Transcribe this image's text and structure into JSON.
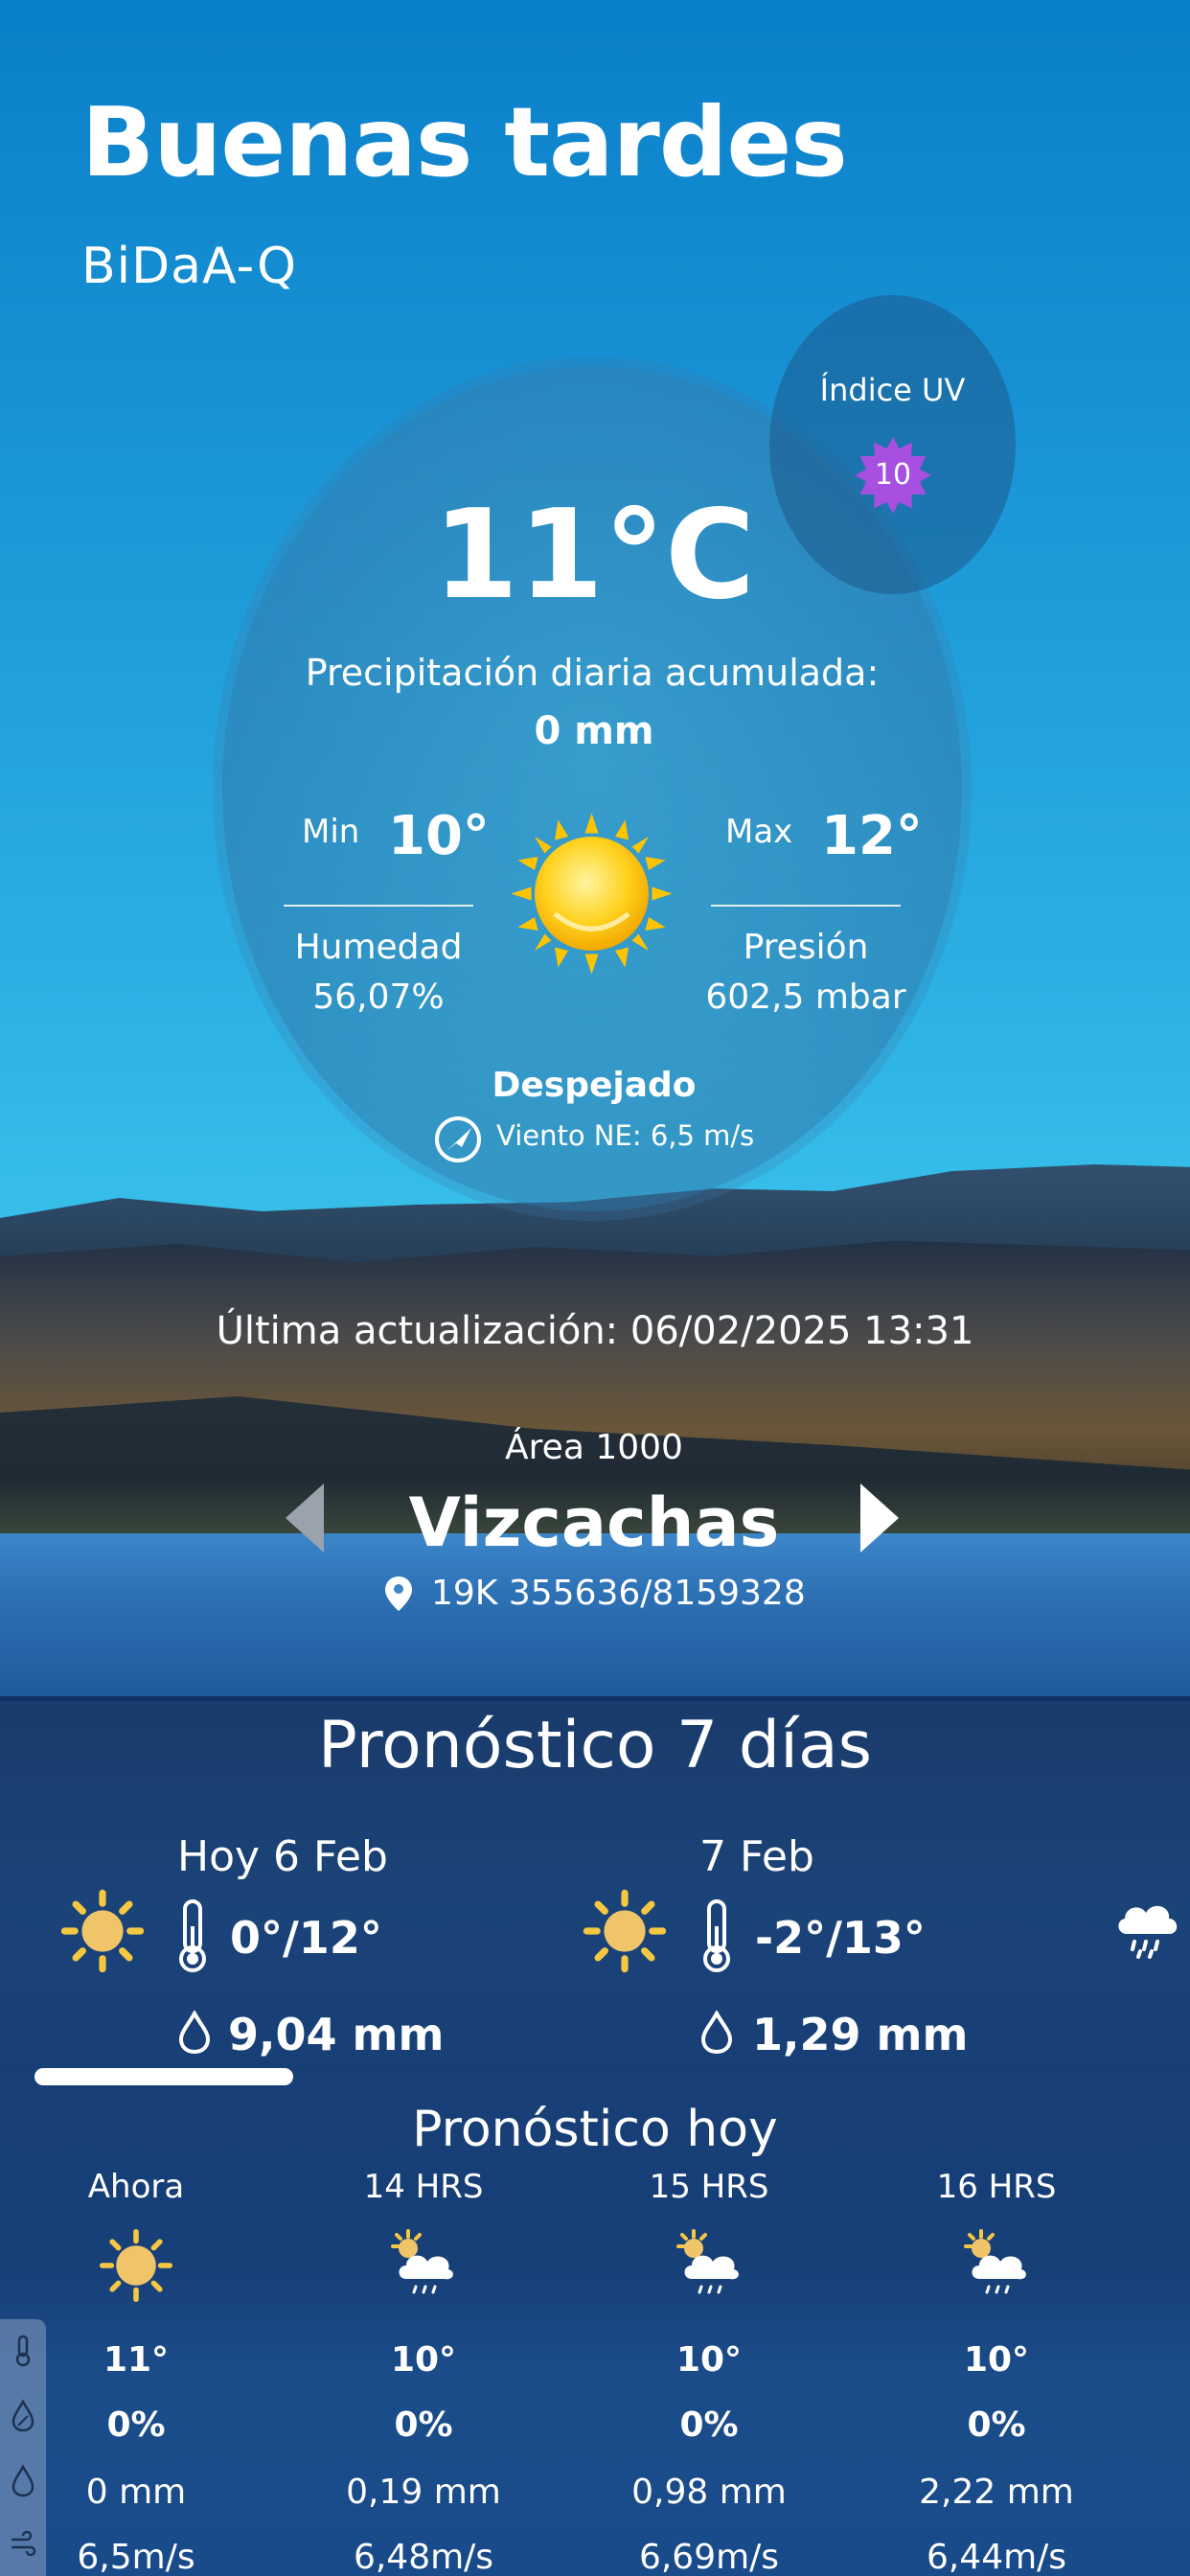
{
  "header": {
    "greeting": "Buenas tardes",
    "station": "BiDaA-Q"
  },
  "uv": {
    "label": "Índice UV",
    "value": "10",
    "color": "#a64fe0"
  },
  "current": {
    "temperature": "11°C",
    "precip_label": "Precipitación diaria acumulada:",
    "precip_value": "0 mm",
    "min_label": "Min",
    "min_value": "10°",
    "max_label": "Max",
    "max_value": "12°",
    "humidity_label": "Humedad",
    "humidity_value": "56,07%",
    "pressure_label": "Presión",
    "pressure_value": "602,5 mbar",
    "condition": "Despejado",
    "wind": "Viento NE: 6,5 m/s",
    "icon": "sun-icon"
  },
  "location": {
    "updated": "Última actualización: 06/02/2025 13:31",
    "area": "Área 1000",
    "name": "Vizcachas",
    "coords": "19K 355636/8159328"
  },
  "forecast7": {
    "title": "Pronóstico 7 días",
    "days": [
      {
        "date": "Hoy 6 Feb",
        "temp": "0°/12°",
        "rain": "9,04 mm",
        "icon": "sun-icon"
      },
      {
        "date": "7 Feb",
        "temp": "-2°/13°",
        "rain": "1,29 mm",
        "icon": "sun-icon"
      },
      {
        "icon": "rain-cloud-icon"
      }
    ]
  },
  "today": {
    "title": "Pronóstico hoy",
    "hours": [
      {
        "label": "Ahora",
        "temp": "11°",
        "pct": "0%",
        "mm": "0 mm",
        "wind": "6,5m/s",
        "icon": "sun-icon"
      },
      {
        "label": "14 HRS",
        "temp": "10°",
        "pct": "0%",
        "mm": "0,19 mm",
        "wind": "6,48m/s",
        "icon": "sun-rain-cloud-icon"
      },
      {
        "label": "15 HRS",
        "temp": "10°",
        "pct": "0%",
        "mm": "0,98 mm",
        "wind": "6,69m/s",
        "icon": "sun-rain-cloud-icon"
      },
      {
        "label": "16 HRS",
        "temp": "10°",
        "pct": "0%",
        "mm": "2,22 mm",
        "wind": "6,44m/s",
        "icon": "sun-rain-cloud-icon"
      }
    ]
  }
}
